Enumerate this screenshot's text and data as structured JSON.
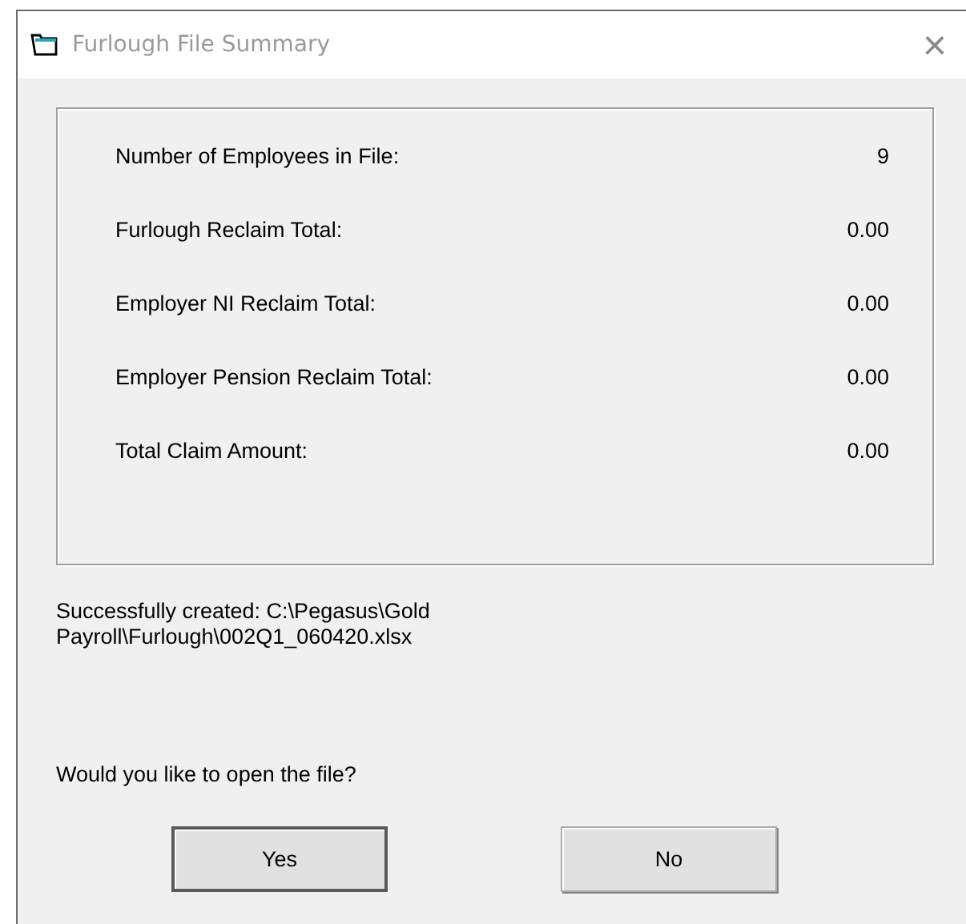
{
  "window": {
    "title": "Furlough File Summary",
    "close": "×"
  },
  "summary": [
    {
      "label": "Number of Employees in File:",
      "value": "9"
    },
    {
      "label": "Furlough Reclaim Total:",
      "value": "0.00"
    },
    {
      "label": "Employer NI Reclaim Total:",
      "value": "0.00"
    },
    {
      "label": "Employer Pension Reclaim Total:",
      "value": "0.00"
    },
    {
      "label": "Total Claim Amount:",
      "value": "0.00"
    }
  ],
  "message": "Successfully created: C:\\Pegasus\\Gold Payroll\\Furlough\\002Q1_060420.xlsx",
  "question": "Would you like to open the file?",
  "buttons": [
    {
      "label": "Yes",
      "default": true
    },
    {
      "label": "No",
      "default": false
    }
  ]
}
